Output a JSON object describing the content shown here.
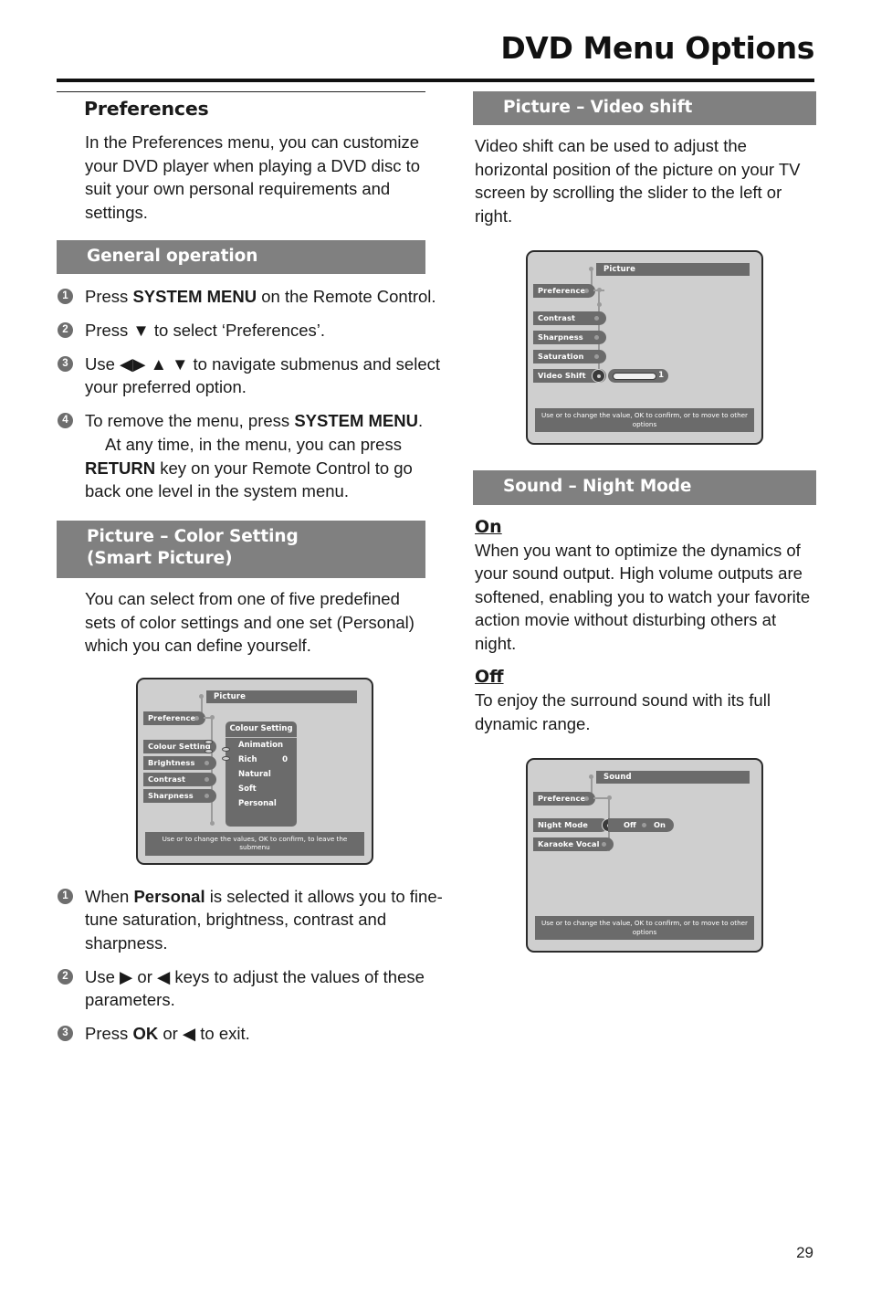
{
  "header": {
    "title": "DVD Menu Options"
  },
  "page_number": "29",
  "left": {
    "preferences": {
      "heading": "Preferences",
      "body": "In the Preferences menu, you can customize your DVD player when playing a DVD disc to suit your own personal requirements and settings."
    },
    "general_operation": {
      "heading": "General operation",
      "steps": [
        {
          "num": "1",
          "html": "Press <b>SYSTEM MENU</b> on the Remote Control."
        },
        {
          "num": "2",
          "html": "Press ▼ to select ‘Preferences’."
        },
        {
          "num": "3",
          "html": "Use ◀▶ ▲ ▼ to navigate submenus and select your preferred option."
        },
        {
          "num": "4",
          "html": "To remove the menu, press <b>SYSTEM MENU</b>.<span class=\"indent-para\">At any time, in the menu, you can press <b>RETURN</b> key on your Remote Control to go back one level in the system menu.</span>"
        }
      ]
    },
    "color_setting": {
      "heading_line1": "Picture  –  Color Setting",
      "heading_line2": "(Smart Picture)",
      "body": "You can select from one of five predefined sets of color settings and one set (Personal) which you can define yourself.",
      "steps": [
        {
          "num": "1",
          "html": "When <b>Personal</b> is selected it allows you to fine-tune saturation, brightness, contrast and sharpness."
        },
        {
          "num": "2",
          "html": "Use ▶ or ◀ keys to adjust the values of these parameters."
        },
        {
          "num": "3",
          "html": "Press <b>OK</b> or ◀ to exit."
        }
      ]
    }
  },
  "right": {
    "video_shift": {
      "heading": "Picture  –  Video shift",
      "body": "Video shift can be used to adjust the horizontal position of the picture on your TV screen by scrolling the slider to the left or right."
    },
    "night_mode": {
      "heading": "Sound  –  Night Mode",
      "on_label": "On",
      "on_body": "When you want to optimize the dynamics of your sound output. High volume outputs are softened, enabling you to watch your favorite action movie without disturbing others at night.",
      "off_label": "Off",
      "off_body": "To enjoy the surround sound with its full dynamic range."
    }
  },
  "osd_color_setting": {
    "title": "Picture",
    "menu_items": [
      "Preference",
      "Colour Setting",
      "Brightness",
      "Contrast",
      "Sharpness"
    ],
    "submenu": {
      "title": "Colour Setting",
      "items": [
        "Animation",
        "Rich",
        "Natural",
        "Soft",
        "Personal"
      ],
      "selected": "Rich",
      "value": "0"
    },
    "caption": "Use   or   to change the values, OK to confirm,      to leave the submenu"
  },
  "osd_video_shift": {
    "title": "Picture",
    "menu_items": [
      "Preference",
      "Contrast",
      "Sharpness",
      "Saturation",
      "Video Shift"
    ],
    "slider": {
      "label": "Video Shift",
      "tick": "1"
    },
    "caption": "Use   or    to change the value, OK to confirm,      or    to move to other options"
  },
  "osd_sound": {
    "title": "Sound",
    "menu_items": [
      "Preference",
      "Night Mode",
      "Karaoke Vocal"
    ],
    "night_mode_options": [
      "Off",
      "On"
    ],
    "caption": "Use   or    to change the value, OK to confirm,      or    to move to other options"
  },
  "colors": {
    "bar_gray": "#808080",
    "osd_gray": "#6b6b6b",
    "osd_bg": "#cfcfcf",
    "bullet_gray": "#6e6e6e"
  }
}
